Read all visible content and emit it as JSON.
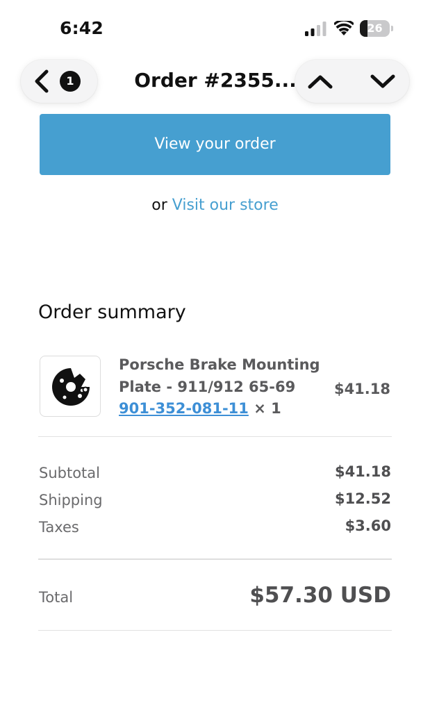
{
  "status_bar": {
    "time": "6:42",
    "battery_level": "26",
    "battery_fraction": 0.26,
    "signal_bars_active": 2,
    "signal_bars_total": 4,
    "icons": [
      "cellular-signal-icon",
      "wifi-icon",
      "battery-icon"
    ]
  },
  "nav": {
    "back_icon": "chevron-left-icon",
    "back_badge": "1",
    "title": "Order #2355...",
    "prev_icon": "chevron-up-icon",
    "next_icon": "chevron-down-icon"
  },
  "actions": {
    "view_order_label": "View your order",
    "or_text": "or",
    "visit_store_label": "Visit our store"
  },
  "summary": {
    "title": "Order summary",
    "item": {
      "name": "Porsche Brake Mounting Plate - 911/912 65-69",
      "sku": "901-352-081-11",
      "quantity": "× 1",
      "price": "$41.18",
      "image_icon": "brake-plate-product-image"
    },
    "rows": [
      {
        "label": "Subtotal",
        "value": "$41.18"
      },
      {
        "label": "Shipping",
        "value": "$12.52"
      },
      {
        "label": "Taxes",
        "value": "$3.60"
      }
    ],
    "total_label": "Total",
    "total_value": "$57.30 USD"
  },
  "colors": {
    "accent": "#469fd0",
    "link": "#3d8fd6",
    "text": "#111111",
    "muted": "#6a6a6c"
  }
}
